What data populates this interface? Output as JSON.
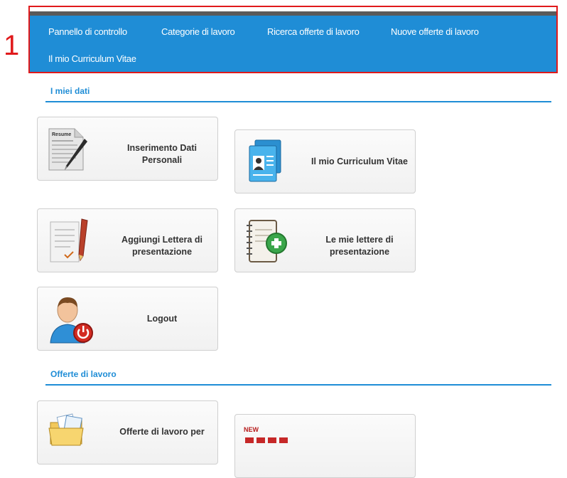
{
  "annotation": {
    "number": "1"
  },
  "nav": {
    "items": [
      {
        "label": "Pannello di controllo"
      },
      {
        "label": "Categorie di lavoro"
      },
      {
        "label": "Ricerca offerte di lavoro"
      },
      {
        "label": "Nuove offerte di lavoro"
      },
      {
        "label": "Il mio Curriculum Vitae"
      }
    ]
  },
  "sections": {
    "my_data": {
      "title": "I miei dati",
      "tiles": {
        "personal_data": {
          "label": "Inserimento Dati Personali",
          "icon": "resume-pen-icon"
        },
        "my_cv": {
          "label": "Il mio Curriculum Vitae",
          "icon": "cv-document-icon"
        },
        "add_cover_letter": {
          "label": "Aggiungi Lettera di presentazione",
          "icon": "letter-pen-icon"
        },
        "my_cover_letters": {
          "label": "Le mie lettere di presentazione",
          "icon": "notebook-add-icon"
        },
        "logout": {
          "label": "Logout",
          "icon": "user-power-icon"
        }
      }
    },
    "job_offers": {
      "title": "Offerte di lavoro",
      "tiles": {
        "offers_for": {
          "label": "Offerte di lavoro per",
          "icon": "folder-documents-icon"
        },
        "new_jobs": {
          "label": "NEW",
          "icon": "new-jobs-icon"
        }
      }
    }
  },
  "colors": {
    "navbar": "#1f8dd6",
    "accent": "#1f8dd6",
    "annotation": "#e0191b"
  }
}
